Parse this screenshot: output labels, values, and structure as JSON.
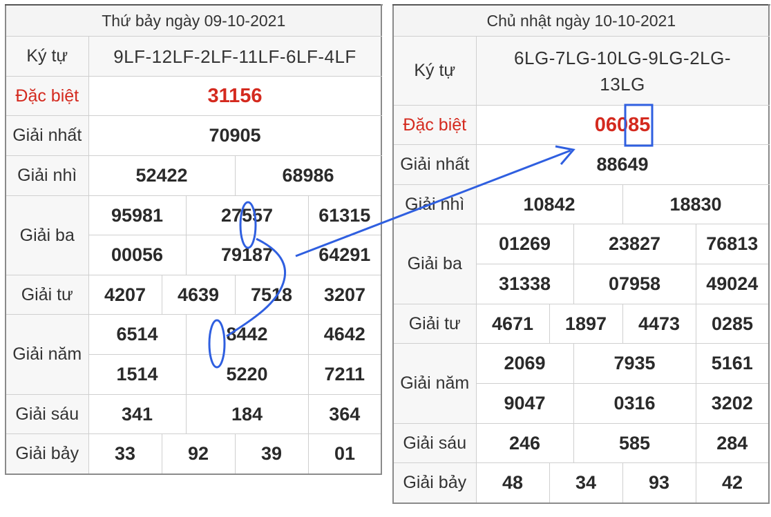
{
  "left": {
    "date_title": "Thứ bảy ngày 09-10-2021",
    "labels": {
      "code": "Ký tự",
      "special": "Đặc biệt",
      "first": "Giải nhất",
      "second": "Giải nhì",
      "third": "Giải ba",
      "fourth": "Giải tư",
      "fifth": "Giải năm",
      "sixth": "Giải sáu",
      "seventh": "Giải bảy"
    },
    "code": "9LF-12LF-2LF-11LF-6LF-4LF",
    "special": "31156",
    "first": "70905",
    "second": [
      "52422",
      "68986"
    ],
    "third": [
      "95981",
      "27557",
      "61315",
      "00056",
      "79187",
      "64291"
    ],
    "fourth": [
      "4207",
      "4639",
      "7518",
      "3207"
    ],
    "fifth": [
      "6514",
      "8442",
      "4642",
      "1514",
      "5220",
      "7211"
    ],
    "sixth": [
      "341",
      "184",
      "364"
    ],
    "seventh": [
      "33",
      "92",
      "39",
      "01"
    ]
  },
  "right": {
    "date_title": "Chủ nhật ngày 10-10-2021",
    "labels": {
      "code": "Ký tự",
      "special": "Đặc biệt",
      "first": "Giải nhất",
      "second": "Giải nhì",
      "third": "Giải ba",
      "fourth": "Giải tư",
      "fifth": "Giải năm",
      "sixth": "Giải sáu",
      "seventh": "Giải bảy"
    },
    "code_line1": "6LG-7LG-10LG-9LG-2LG-",
    "code_line2": "13LG",
    "special": "06085",
    "first": "88649",
    "second": [
      "10842",
      "18830"
    ],
    "third": [
      "01269",
      "23827",
      "76813",
      "31338",
      "07958",
      "49024"
    ],
    "fourth": [
      "4671",
      "1897",
      "4473",
      "0285"
    ],
    "fifth": [
      "2069",
      "7935",
      "5161",
      "9047",
      "0316",
      "3202"
    ],
    "sixth": [
      "246",
      "585",
      "284"
    ],
    "seventh": [
      "48",
      "34",
      "93",
      "42"
    ]
  },
  "colors": {
    "special": "#d42a1f",
    "annotation": "#2f5fe0",
    "border": "#cfcfcf"
  }
}
